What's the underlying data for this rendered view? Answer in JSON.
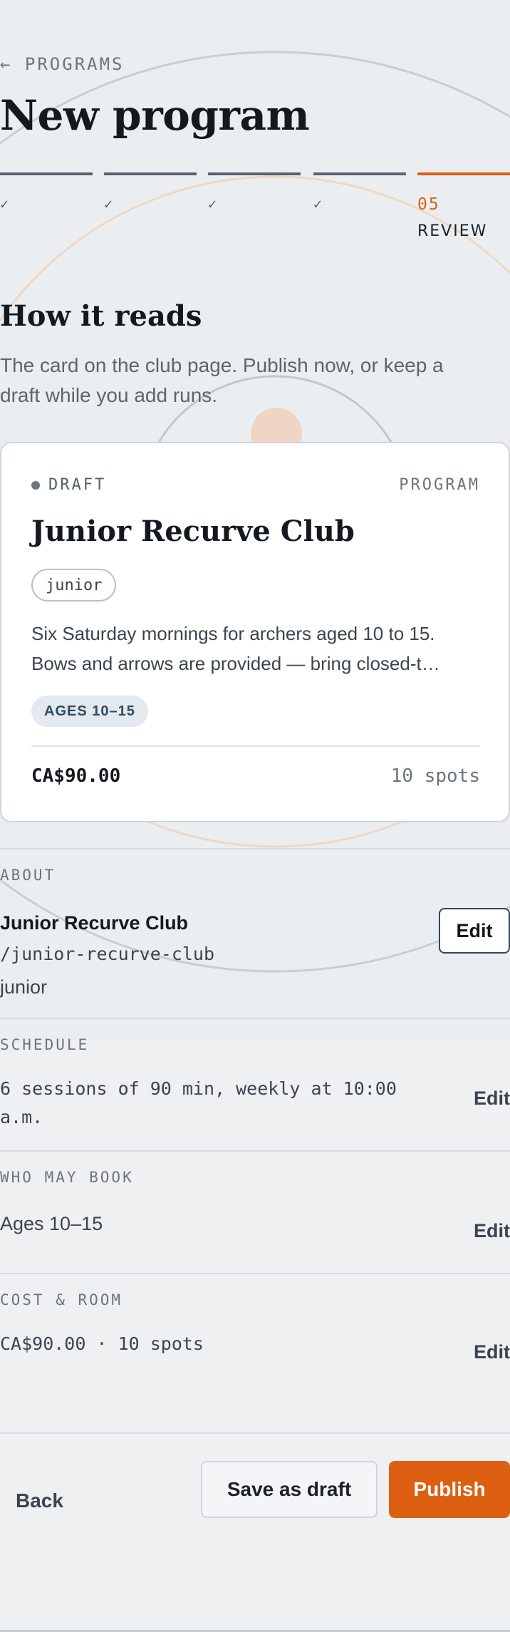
{
  "header": {
    "breadcrumb": "← PROGRAMS",
    "title": "New program"
  },
  "steps": [
    {
      "mark": "✓",
      "state": "done"
    },
    {
      "mark": "✓",
      "state": "done"
    },
    {
      "mark": "✓",
      "state": "done"
    },
    {
      "mark": "✓",
      "state": "done"
    },
    {
      "mark": "05",
      "label": "REVIEW",
      "state": "current"
    }
  ],
  "preview": {
    "heading": "How it reads",
    "lead": "The card on the club page. Publish now, or keep a draft while you add runs.",
    "card": {
      "status": "DRAFT",
      "type": "PROGRAM",
      "title": "Junior Recurve Club",
      "tag": "junior",
      "desc_line1": "Six Saturday mornings for archers aged 10 to 15.",
      "desc_line2": "Bows and arrows are provided — bring closed-t…",
      "ages": "AGES 10–15",
      "price": "CA$90.00",
      "spots": "10 spots"
    }
  },
  "sections": {
    "about": {
      "label": "ABOUT",
      "name": "Junior Recurve Club",
      "slug": "/junior-recurve-club",
      "tag": "junior",
      "edit": "Edit"
    },
    "schedule": {
      "label": "SCHEDULE",
      "line1": "6 sessions of 90 min, weekly at 10:00",
      "line2": "a.m.",
      "edit": "Edit"
    },
    "who": {
      "label": "WHO MAY BOOK",
      "value": "Ages 10–15",
      "edit": "Edit"
    },
    "cost": {
      "label": "COST & ROOM",
      "value": "CA$90.00 · 10 spots",
      "edit": "Edit"
    }
  },
  "footer": {
    "back": "Back",
    "save_draft": "Save as draft",
    "publish": "Publish"
  },
  "colors": {
    "accent": "#dd5f12",
    "background": "#eef0f2",
    "ink": "#141920",
    "muted": "#6b7480"
  }
}
